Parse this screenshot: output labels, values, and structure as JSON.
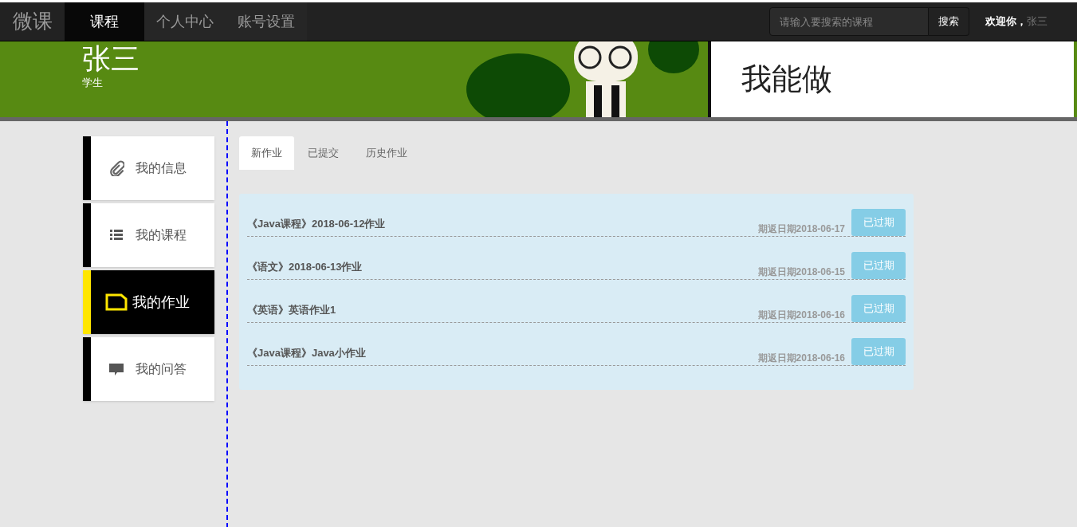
{
  "navbar": {
    "brand": "微课",
    "tabs": [
      {
        "label": "课程",
        "selected": true
      },
      {
        "label": "个人中心",
        "selected": false
      },
      {
        "label": "账号设置",
        "selected": false
      }
    ],
    "search": {
      "placeholder": "请输入要搜索的课程",
      "button": "搜索"
    },
    "welcome": "欢迎你，",
    "user": "张三"
  },
  "banner": {
    "name": "张三",
    "role": "学生",
    "slogan": "我能做"
  },
  "sidebar": {
    "items": [
      {
        "label": "我的信息",
        "selected": false
      },
      {
        "label": "我的课程",
        "selected": false
      },
      {
        "label": "我的作业",
        "selected": true
      },
      {
        "label": "我的问答",
        "selected": false
      }
    ]
  },
  "tabs": [
    {
      "label": "新作业",
      "selected": true
    },
    {
      "label": "已提交",
      "selected": false
    },
    {
      "label": "历史作业",
      "selected": false
    }
  ],
  "assignments": [
    {
      "title": "《Java课程》2018-06-12作业",
      "due": "期返日期2018-06-17",
      "status": "已过期"
    },
    {
      "title": "《语文》2018-06-13作业",
      "due": "期返日期2018-06-15",
      "status": "已过期"
    },
    {
      "title": "《英语》英语作业1",
      "due": "期返日期2018-06-16",
      "status": "已过期"
    },
    {
      "title": "《Java课程》Java小作业",
      "due": "期返日期2018-06-16",
      "status": "已过期"
    }
  ]
}
